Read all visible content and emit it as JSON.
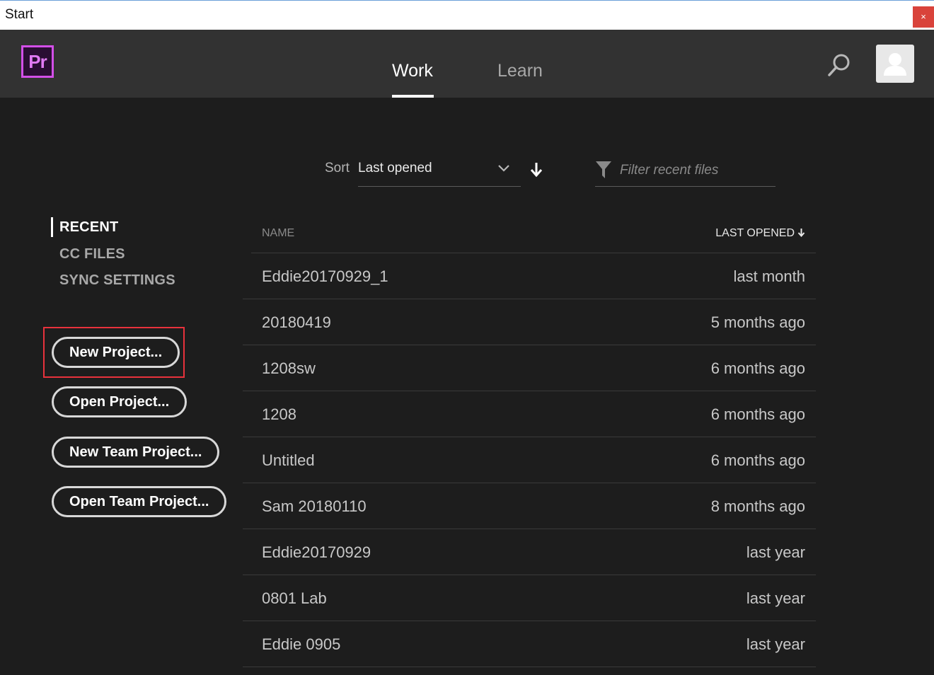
{
  "window": {
    "title": "Start",
    "close_label": "×"
  },
  "header": {
    "logo_text": "Pr",
    "tabs": [
      {
        "label": "Work",
        "active": true
      },
      {
        "label": "Learn",
        "active": false
      }
    ],
    "icons": {
      "search": "search-icon",
      "avatar": "user-avatar-icon"
    }
  },
  "toolbar": {
    "sort_label": "Sort",
    "sort_value": "Last opened",
    "sort_direction": "descending",
    "filter_placeholder": "Filter recent files",
    "filter_value": ""
  },
  "sidebar": {
    "nav": [
      {
        "label": "RECENT",
        "active": true
      },
      {
        "label": "CC FILES",
        "active": false
      },
      {
        "label": "SYNC SETTINGS",
        "active": false
      }
    ],
    "buttons": [
      {
        "label": "New Project..."
      },
      {
        "label": "Open Project..."
      },
      {
        "label": "New Team Project..."
      },
      {
        "label": "Open Team Project..."
      }
    ]
  },
  "table": {
    "columns": {
      "name": "NAME",
      "last_opened": "LAST OPENED"
    },
    "rows": [
      {
        "name": "Eddie20170929_1",
        "last_opened": "last month"
      },
      {
        "name": "20180419",
        "last_opened": "5 months ago"
      },
      {
        "name": "1208sw",
        "last_opened": "6 months ago"
      },
      {
        "name": "1208",
        "last_opened": "6 months ago"
      },
      {
        "name": "Untitled",
        "last_opened": "6 months ago"
      },
      {
        "name": "Sam 20180110",
        "last_opened": "8 months ago"
      },
      {
        "name": "Eddie20170929",
        "last_opened": "last year"
      },
      {
        "name": "0801 Lab",
        "last_opened": "last year"
      },
      {
        "name": "Eddie 0905",
        "last_opened": "last year"
      }
    ]
  },
  "colors": {
    "background": "#1d1d1d",
    "header": "#323232",
    "accent_premiere": "#d34fe8",
    "highlight": "#e8323c"
  }
}
